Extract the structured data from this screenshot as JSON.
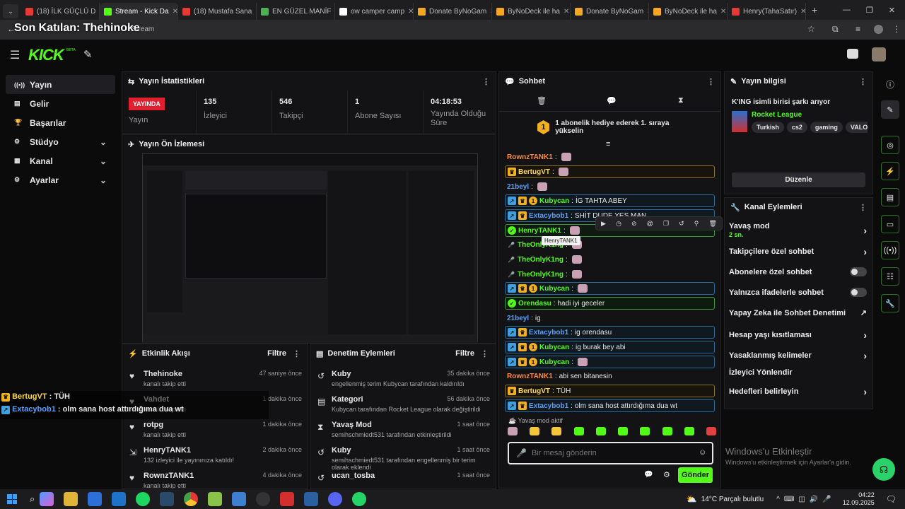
{
  "browser": {
    "tabs": [
      {
        "label": "(18) İLK GÜÇLÜ D",
        "color": "#e53935"
      },
      {
        "label": "Stream - Kick Da",
        "color": "#53fc18",
        "active": true
      },
      {
        "label": "(18) Mustafa Sana",
        "color": "#e53935"
      },
      {
        "label": "EN GÜZEL MANİF",
        "color": "#4caf50"
      },
      {
        "label": "ow camper camp",
        "color": "#ffffff"
      },
      {
        "label": "Donate ByNoGam",
        "color": "#f5a623"
      },
      {
        "label": "ByNoDeck ile ha",
        "color": "#f5a623"
      },
      {
        "label": "Donate ByNoGam",
        "color": "#f5a623"
      },
      {
        "label": "ByNoDeck ile ha",
        "color": "#f5a623"
      },
      {
        "label": "Henry(TahaSatır)",
        "color": "#e53935"
      }
    ],
    "url_text": "Stream",
    "overlay_title": "Son Katılan: Thehinoke"
  },
  "nav": {
    "logo": "KICK",
    "beta": "BETA"
  },
  "sidebar": {
    "items": [
      {
        "label": "Yayın",
        "icon": "broadcast-icon",
        "chev": ""
      },
      {
        "label": "Gelir",
        "icon": "income-icon",
        "chev": ""
      },
      {
        "label": "Başarılar",
        "icon": "trophy-icon",
        "chev": ""
      },
      {
        "label": "Stüdyo",
        "icon": "studio-icon",
        "chev": "⌄"
      },
      {
        "label": "Kanal",
        "icon": "channel-icon",
        "chev": "⌄"
      },
      {
        "label": "Ayarlar",
        "icon": "gear-icon",
        "chev": "⌄"
      }
    ]
  },
  "stats": {
    "title": "Yayın İstatistikleri",
    "live_badge": "YAYINDA",
    "live_label": "Yayın",
    "viewers": "135",
    "viewers_label": "İzleyici",
    "followers": "546",
    "followers_label": "Takipçi",
    "subs": "1",
    "subs_label": "Abone Sayısı",
    "duration": "04:18:53",
    "duration_label": "Yayında Olduğu Süre"
  },
  "preview": {
    "title": "Yayın Ön İzlemesi"
  },
  "activity": {
    "title": "Etkinlik Akışı",
    "filter": "Filtre",
    "rows": [
      {
        "name": "Thehinoke",
        "sub": "kanalı takip etti",
        "time": "47 saniye önce"
      },
      {
        "name": "Vahdet",
        "sub": "kanalı takip etti",
        "time": "1 dakika önce"
      },
      {
        "name": "rotpg",
        "sub": "kanalı takip etti",
        "time": "1 dakika önce"
      },
      {
        "name": "HenryTANK1",
        "sub": "132 izleyici ile yayınınıza katıldı!",
        "time": "2 dakika önce"
      },
      {
        "name": "RownzTANK1",
        "sub": "kanalı takip etti",
        "time": "4 dakika önce"
      }
    ]
  },
  "modlog": {
    "title": "Denetim Eylemleri",
    "filter": "Filtre",
    "rows": [
      {
        "name": "Kuby",
        "sub": "engellenmiş terim Kubycan tarafından kaldırıldı",
        "time": "35 dakika önce"
      },
      {
        "name": "Kategori",
        "sub": "Kubycan tarafından Rocket League olarak değiştirildi",
        "time": "56 dakika önce"
      },
      {
        "name": "Yavaş Mod",
        "sub": "semihschmiedt531 tarafından etkinleştirildi",
        "time": "1 saat önce"
      },
      {
        "name": "Kuby",
        "sub": "semihschmiedt531 tarafından engellenmiş bir terim olarak eklendi",
        "time": "1 saat önce"
      },
      {
        "name": "ucan_tosba",
        "sub": "",
        "time": "1 saat önce"
      }
    ]
  },
  "chat": {
    "title": "Sohbet",
    "pinned": "1 abonelik hediye ederek 1. sıraya yükselin",
    "pinned_rank": "1",
    "lines": [
      {
        "user": "RownzTANK1",
        "color": "#ff8a3d",
        "text": "",
        "style": "",
        "emote": true
      },
      {
        "user": "BertugVT",
        "color": "#ffd84d",
        "text": "",
        "style": "gold",
        "emote": true
      },
      {
        "user": "21beyl",
        "color": "#5aa0ff",
        "text": "",
        "style": "",
        "emote": true
      },
      {
        "user": "Kubycan",
        "color": "#53fc18",
        "text": "İG TAHTA ABEY",
        "style": "box",
        "emote": false
      },
      {
        "user": "Extacybob1",
        "color": "#5aa0ff",
        "text": "SHİT DUDE YES MAN",
        "style": "box",
        "emote": false
      },
      {
        "user": "HenryTANK1",
        "color": "#53fc18",
        "text": "",
        "style": "green",
        "emote": true
      },
      {
        "user": "TheOnlyK1ng",
        "color": "#53fc18",
        "text": "",
        "style": "",
        "emote": true
      },
      {
        "user": "TheOnlyK1ng",
        "color": "#53fc18",
        "text": "",
        "style": "",
        "emote": true
      },
      {
        "user": "TheOnlyK1ng",
        "color": "#53fc18",
        "text": "",
        "style": "",
        "emote": true
      },
      {
        "user": "Kubycan",
        "color": "#53fc18",
        "text": "",
        "style": "box",
        "emote": true
      },
      {
        "user": "Orendasu",
        "color": "#53fc18",
        "text": "hadi iyi geceler",
        "style": "green",
        "emote": false
      },
      {
        "user": "21beyl",
        "color": "#5aa0ff",
        "text": "ig",
        "style": "",
        "emote": false
      },
      {
        "user": "Extacybob1",
        "color": "#5aa0ff",
        "text": "ig orendasu",
        "style": "box",
        "emote": false
      },
      {
        "user": "Kubycan",
        "color": "#53fc18",
        "text": "ig burak bey abi",
        "style": "box",
        "emote": false
      },
      {
        "user": "Kubycan",
        "color": "#53fc18",
        "text": "",
        "style": "box",
        "emote": true
      },
      {
        "user": "RownzTANK1",
        "color": "#ff8a3d",
        "text": "abi sen bitanesin",
        "style": "",
        "emote": false
      },
      {
        "user": "BertugVT",
        "color": "#ffd84d",
        "text": "TÜH",
        "style": "gold",
        "emote": false
      },
      {
        "user": "Extacybob1",
        "color": "#5aa0ff",
        "text": "olm sana host attırdığıma dua wt",
        "style": "box",
        "emote": false
      }
    ],
    "tooltip": "HenryTANK1",
    "slow_mode": "Yavaş mod aktif",
    "input_placeholder": "Bir mesaj gönderin",
    "send": "Gönder"
  },
  "stream_info": {
    "title": "Yayın bilgisi",
    "stream_title": "K'ING isimli birisi şarkı arıyor",
    "category": "Rocket League",
    "tags": [
      "Turkish",
      "cs2",
      "gaming",
      "VALO"
    ],
    "edit": "Düzenle"
  },
  "channel_actions": {
    "title": "Kanal Eylemleri",
    "items": [
      {
        "label": "Yavaş mod",
        "sub": "2 sn.",
        "kind": "chevron"
      },
      {
        "label": "Takipçilere özel sohbet",
        "sub": "",
        "kind": "chevron"
      },
      {
        "label": "Abonelere özel sohbet",
        "sub": "",
        "kind": "toggle"
      },
      {
        "label": "Yalnızca ifadelerle sohbet",
        "sub": "",
        "kind": "toggle"
      },
      {
        "label": "Yapay Zeka ile Sohbet Denetimi",
        "sub": "",
        "kind": "ext"
      },
      {
        "label": "Hesap yaşı kısıtlaması",
        "sub": "",
        "kind": "chevron"
      },
      {
        "label": "Yasaklanmış kelimeler",
        "sub": "",
        "kind": "chevron"
      },
      {
        "label": "İzleyici Yönlendir",
        "sub": "",
        "kind": ""
      },
      {
        "label": "Hedefleri belirleyin",
        "sub": "",
        "kind": "chevron"
      }
    ]
  },
  "overlay": {
    "line1_user": "BertugVT",
    "line1_text": " : TÜH",
    "line2_user": "Extacybob1",
    "line2_text": " : olm sana host attırdığıma dua wt"
  },
  "watermark": {
    "line1": "Windows'u Etkinleştir",
    "line2": "Windows'u etkinleştirmek için Ayarlar'a gidin."
  },
  "taskbar": {
    "weather": "14°C  Parçalı bulutlu",
    "time": "04:22",
    "date": "12.09.2025"
  }
}
